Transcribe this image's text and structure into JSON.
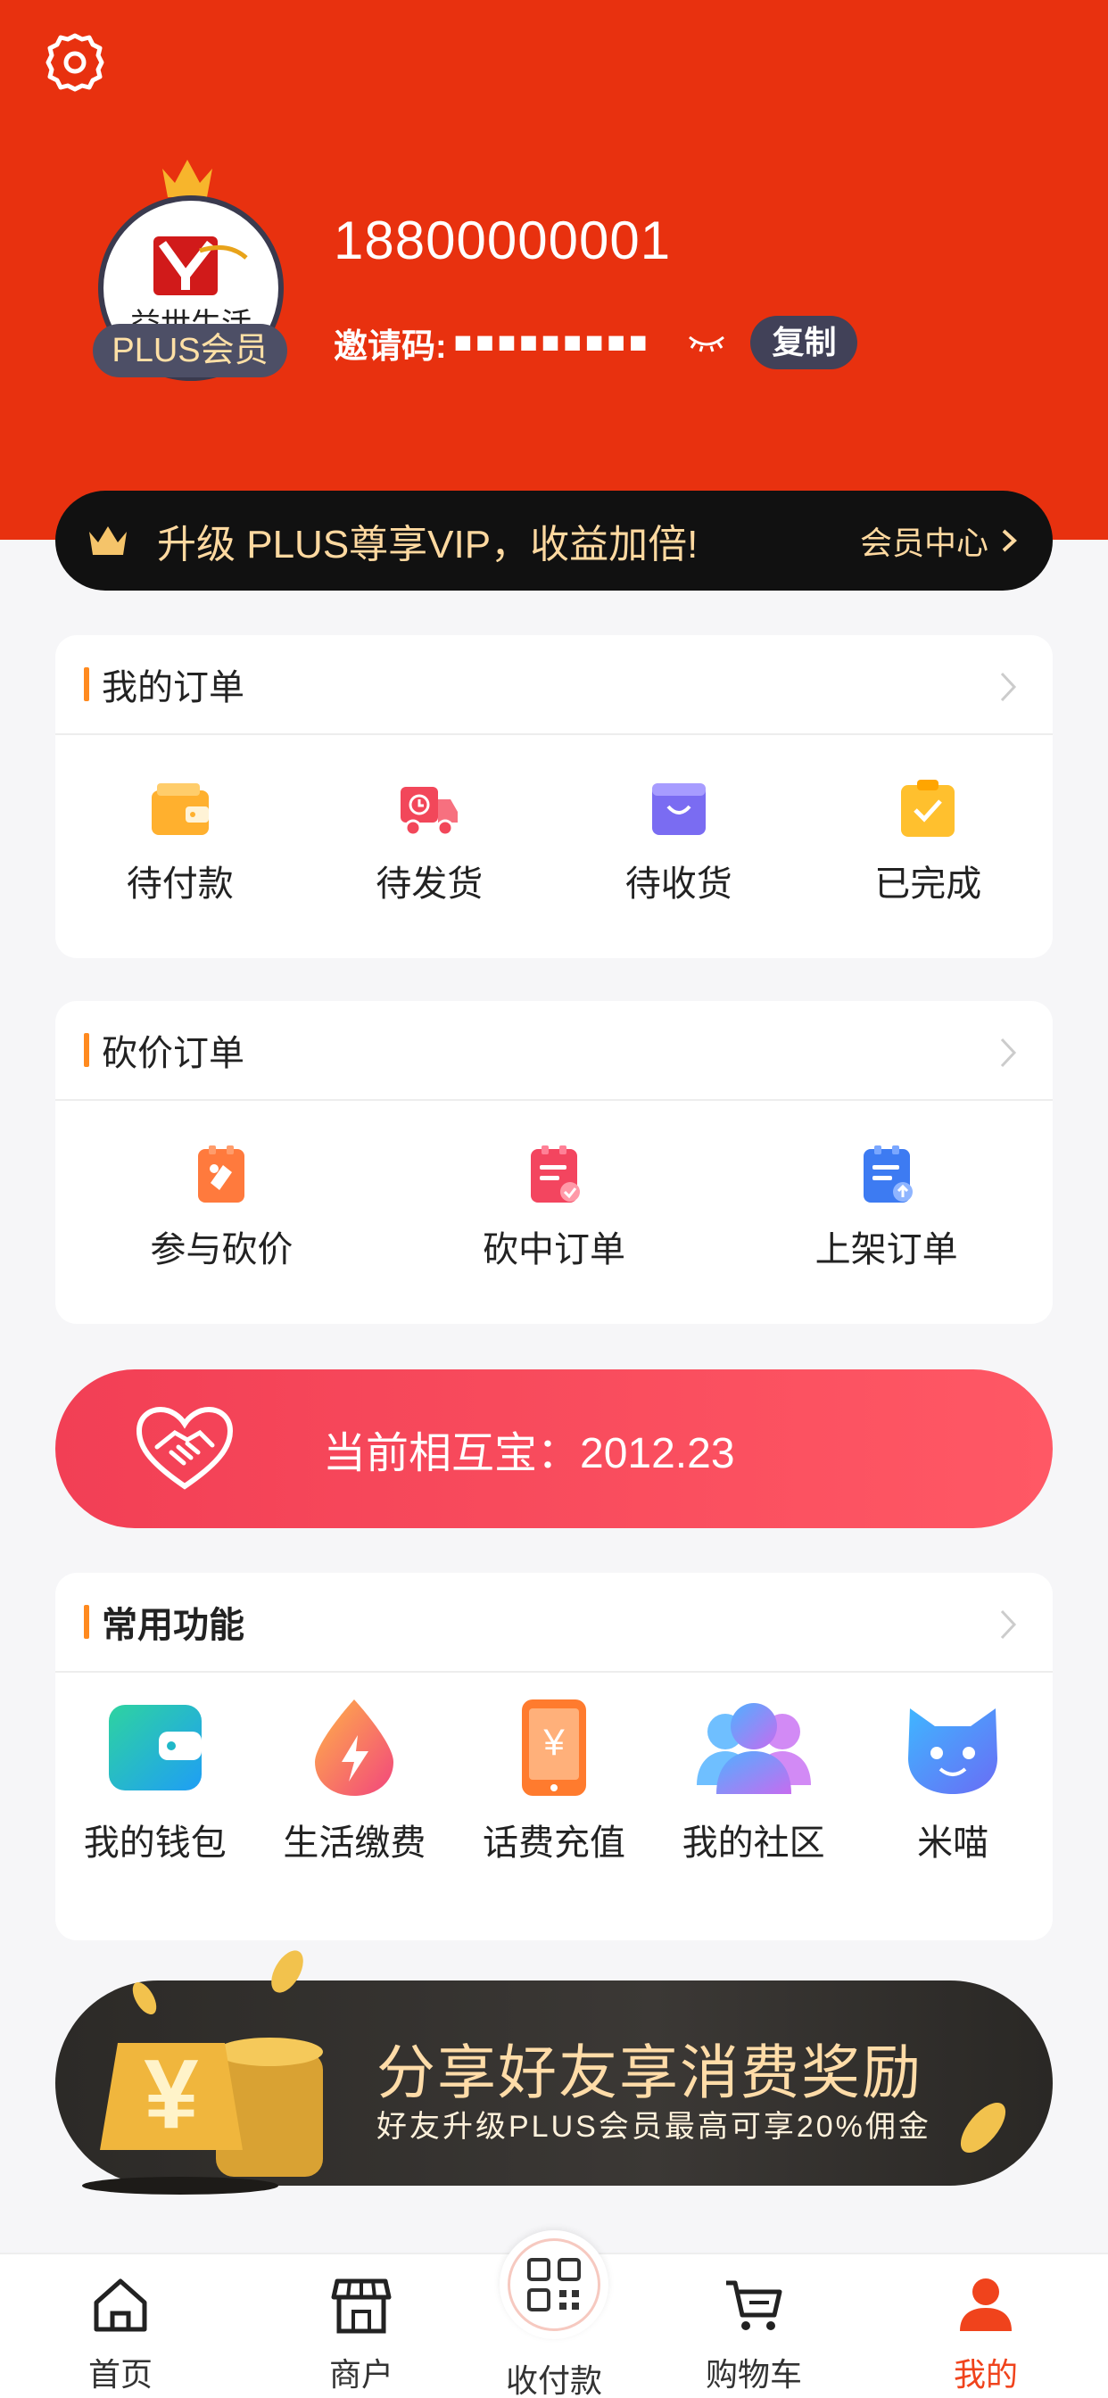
{
  "colors": {
    "header": "#e8310f",
    "vip_text": "#ffd9a0",
    "accent_mark": "#ff8a1f",
    "mutual": "#f6465a",
    "tab_active": "#f0431c"
  },
  "header": {
    "settings_icon": "gear-icon",
    "avatar_text": "益世生活",
    "badge": "PLUS会员",
    "phone": "18800000001",
    "invite_label": "邀请码:",
    "invite_code": "■■■■■■■■■",
    "copy_label": "复制"
  },
  "vip": {
    "text": "升级 PLUS尊享VIP，收益加倍!",
    "link": "会员中心"
  },
  "orders": {
    "title": "我的订单",
    "items": [
      {
        "label": "待付款",
        "icon": "wallet-icon"
      },
      {
        "label": "待发货",
        "icon": "truck-icon"
      },
      {
        "label": "待收货",
        "icon": "box-icon"
      },
      {
        "label": "已完成",
        "icon": "clipboard-check-icon"
      }
    ]
  },
  "bargain": {
    "title": "砍价订单",
    "items": [
      {
        "label": "参与砍价",
        "icon": "bargain-icon"
      },
      {
        "label": "砍中订单",
        "icon": "order-check-icon"
      },
      {
        "label": "上架订单",
        "icon": "order-upload-icon"
      }
    ]
  },
  "mutual": {
    "text": "当前相互宝：2012.23"
  },
  "functions": {
    "title": "常用功能",
    "items": [
      {
        "label": "我的钱包",
        "icon": "wallet-icon"
      },
      {
        "label": "生活缴费",
        "icon": "bolt-icon"
      },
      {
        "label": "话费充值",
        "icon": "phone-icon"
      },
      {
        "label": "我的社区",
        "icon": "community-icon"
      },
      {
        "label": "米喵",
        "icon": "cat-icon"
      }
    ]
  },
  "banner": {
    "title": "分享好友享消费奖励",
    "subtitle": "好友升级PLUS会员最高可享20%佣金"
  },
  "tabbar": {
    "items": [
      {
        "label": "首页",
        "icon": "home-icon"
      },
      {
        "label": "商户",
        "icon": "store-icon"
      },
      {
        "label": "收付款",
        "icon": "qr-icon"
      },
      {
        "label": "购物车",
        "icon": "cart-icon"
      },
      {
        "label": "我的",
        "icon": "user-icon"
      }
    ]
  }
}
